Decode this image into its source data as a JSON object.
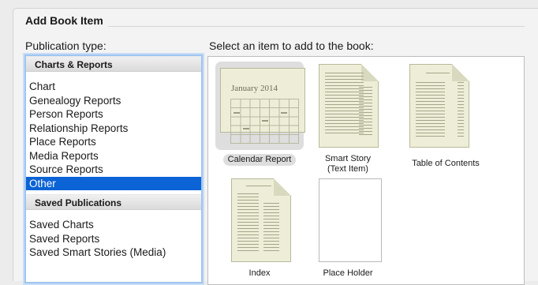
{
  "dialog": {
    "title": "Add Book Item",
    "publication_type_label": "Publication type:",
    "select_label": "Select an item to add to the book:"
  },
  "sections": [
    {
      "header": "Charts & Reports",
      "items": [
        "Chart",
        "Genealogy Reports",
        "Person Reports",
        "Relationship Reports",
        "Place Reports",
        "Media Reports",
        "Source Reports",
        "Other"
      ]
    },
    {
      "header": "Saved Publications",
      "items": [
        "Saved Charts",
        "Saved Reports",
        "Saved Smart Stories (Media)"
      ]
    }
  ],
  "selected_item": "Other",
  "tiles": [
    {
      "label": "Calendar Report",
      "calendar_text": "January 2014",
      "selected": true
    },
    {
      "label": "Smart Story\n(Text Item)",
      "selected": false
    },
    {
      "label": "Table of Contents",
      "selected": false
    },
    {
      "label": "Index",
      "selected": false
    },
    {
      "label": "Place Holder",
      "selected": false
    }
  ],
  "colors": {
    "selection": "#0b63d6",
    "focus_ring": "#9ec5f0",
    "thumbnail_paper": "#eeeed8"
  }
}
